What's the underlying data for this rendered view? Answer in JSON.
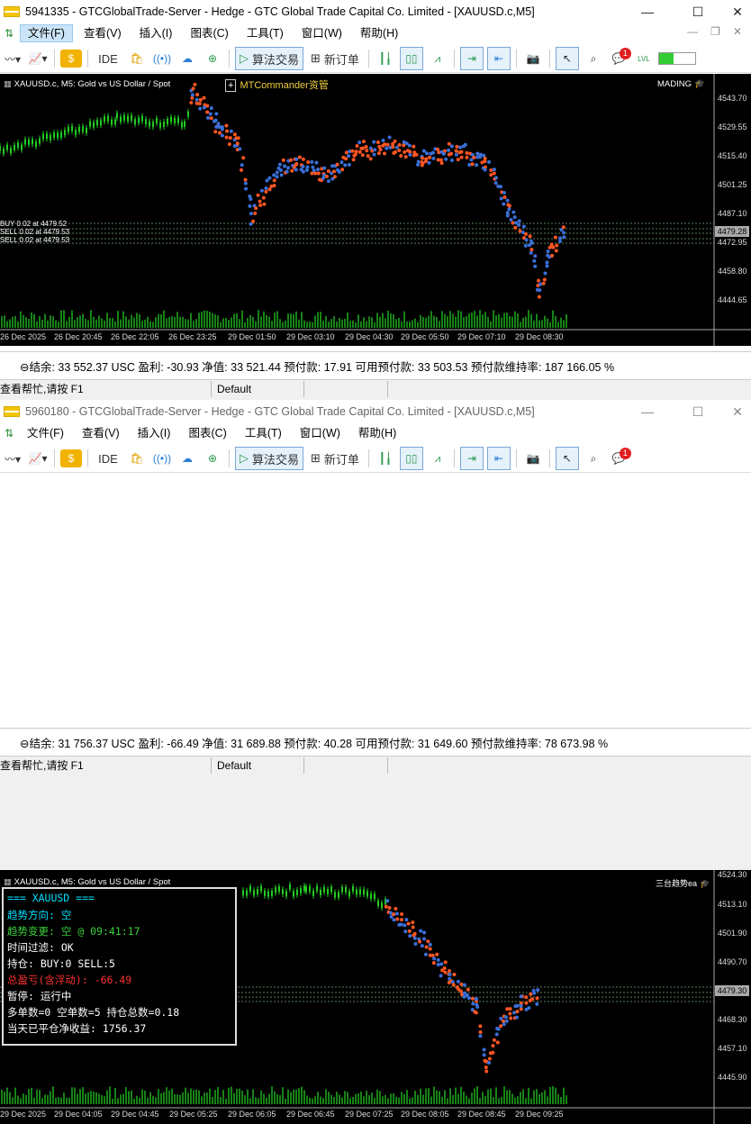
{
  "windows": [
    {
      "title": "5941335 - GTCGlobalTrade-Server - Hedge - GTC Global Trade Capital Co. Limited - [XAUUSD.c,M5]",
      "menu": [
        "文件(F)",
        "查看(V)",
        "插入(I)",
        "图表(C)",
        "工具(T)",
        "窗口(W)",
        "帮助(H)"
      ],
      "toolbar": {
        "ide": "IDE",
        "algo": "算法交易",
        "new_order": "新订单",
        "notif_count": "1",
        "lvl": "LVL"
      },
      "chart": {
        "symbol_label": "XAUUSD.c, M5:  Gold vs US Dollar / Spot",
        "ea_label": "MTCommander资管",
        "ea_right": "MADING",
        "pos_lines": [
          "BUY 0.02 at 4479.52",
          "SELL 0.02 at 4479.53",
          "SELL 0.02 at 4479.53"
        ],
        "price_labels": [
          "4543.70",
          "4529.55",
          "4515.40",
          "4501.25",
          "4487.10",
          "4472.95",
          "4458.80",
          "4444.65"
        ],
        "current_price": "4479.28",
        "time_labels": [
          "26 Dec 2025",
          "26 Dec 20:45",
          "26 Dec 22:05",
          "26 Dec 23:25",
          "29 Dec 01:50",
          "29 Dec 03:10",
          "29 Dec 04:30",
          "29 Dec 05:50",
          "29 Dec 07:10",
          "29 Dec 08:30"
        ]
      },
      "status": "⊖结余: 33 552.37 USC  盈利: -30.93  净值: 33 521.44  预付款: 17.91  可用预付款: 33 503.53  预付款维持率: 187 166.05 %",
      "strip": {
        "help": "查看帮忙,请按 F1",
        "profile": "Default"
      }
    },
    {
      "title": "5960180 - GTCGlobalTrade-Server - Hedge - GTC Global Trade Capital Co. Limited - [XAUUSD.c,M5]",
      "menu": [
        "文件(F)",
        "查看(V)",
        "插入(I)",
        "图表(C)",
        "工具(T)",
        "窗口(W)",
        "帮助(H)"
      ],
      "toolbar": {
        "ide": "IDE",
        "algo": "算法交易",
        "new_order": "新订单",
        "notif_count": "1"
      },
      "chart": {
        "symbol_label": "XAUUSD.c, M5:  Gold vs US Dollar / Spot",
        "ea_right": "三台趋势ea",
        "price_labels": [
          "4524.30",
          "4513.10",
          "4501.90",
          "4490.70",
          "4479.30",
          "4468.30",
          "4457.10",
          "4445.90"
        ],
        "current_price": "4479.30",
        "time_labels": [
          "29 Dec 2025",
          "29 Dec 04:05",
          "29 Dec 04:45",
          "29 Dec 05:25",
          "29 Dec 06:05",
          "29 Dec 06:45",
          "29 Dec 07:25",
          "29 Dec 08:05",
          "29 Dec 08:45",
          "29 Dec 09:25"
        ]
      },
      "panel": [
        {
          "text": "===  XAUUSD  ===",
          "color": "#00e0ff"
        },
        {
          "text": "趋势方向: 空",
          "color": "#00e0ff"
        },
        {
          "text": "趋势变更: 空 @ 09:41:17",
          "color": "#3ad13a"
        },
        {
          "text": "时间过滤: OK",
          "color": "#ffffff"
        },
        {
          "text": "持仓: BUY:0   SELL:5",
          "color": "#ffffff"
        },
        {
          "text": "总盈亏(含浮动): -66.49",
          "color": "#ff3030"
        },
        {
          "text": "暂停: 运行中",
          "color": "#ffffff"
        },
        {
          "text": "多单数=0 空单数=5 持仓总数=0.18",
          "color": "#ffffff"
        },
        {
          "text": "当天已平仓净收益: 1756.37",
          "color": "#ffffff"
        }
      ],
      "status": "⊖结余: 31 756.37 USC  盈利: -66.49  净值: 31 689.88  预付款: 40.28  可用预付款: 31 649.60  预付款维持率: 78 673.98 %",
      "strip": {
        "help": "查看帮忙,请按 F1",
        "profile": "Default"
      }
    }
  ],
  "colors": {
    "bull": "#22cc22",
    "bear": "#ff5522",
    "buy_dot": "#3a6fd8",
    "grid": "#888888"
  }
}
